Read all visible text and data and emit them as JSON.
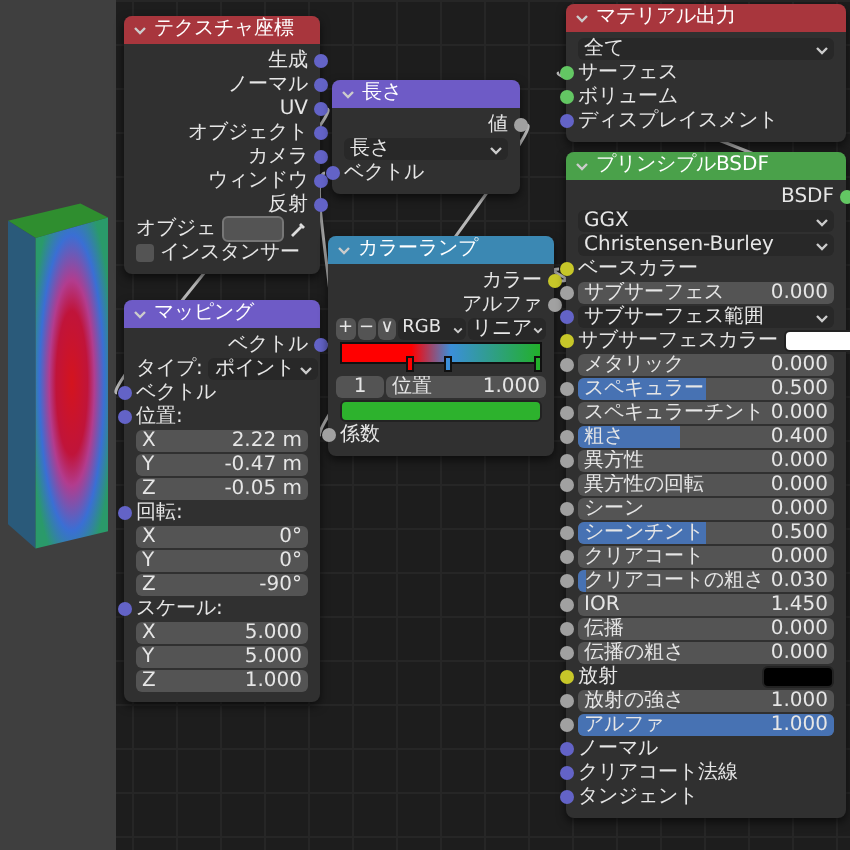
{
  "nodes": [
    {
      "title": "テクスチャ座標",
      "color": "#a8363d",
      "rows": [
        {
          "kind": "output",
          "label": "生成",
          "socket": {
            "color": "#6363c7"
          }
        },
        {
          "kind": "output",
          "label": "ノーマル",
          "socket": {
            "color": "#6363c7"
          }
        },
        {
          "kind": "output",
          "label": "UV",
          "socket": {
            "color": "#6363c7"
          }
        },
        {
          "kind": "output",
          "label": "オブジェクト",
          "socket": {
            "color": "#6363c7"
          }
        },
        {
          "kind": "output",
          "label": "カメラ",
          "socket": {
            "color": "#6363c7"
          }
        },
        {
          "kind": "output",
          "label": "ウィンドウ",
          "socket": {
            "color": "#6363c7"
          }
        },
        {
          "kind": "output",
          "label": "反射",
          "socket": {
            "color": "#6363c7"
          }
        },
        {
          "kind": "object",
          "label": "オブジェ"
        },
        {
          "kind": "checkbox",
          "label": "インスタンサー",
          "checked": false
        }
      ]
    },
    {
      "title": "マッピング",
      "color": "#6e5bc6",
      "rows": [
        {
          "kind": "output",
          "label": "ベクトル",
          "socket": {
            "color": "#6363c7"
          }
        },
        {
          "kind": "dropdown",
          "label": "タイプ:",
          "value": "ポイント"
        },
        {
          "kind": "input",
          "label": "ベクトル",
          "socket": {
            "color": "#6363c7"
          }
        },
        {
          "kind": "heading",
          "label": "位置:",
          "socket": {
            "color": "#6363c7"
          }
        },
        {
          "kind": "number",
          "label": "X",
          "value": "2.22 m"
        },
        {
          "kind": "number",
          "label": "Y",
          "value": "-0.47 m"
        },
        {
          "kind": "number",
          "label": "Z",
          "value": "-0.05 m"
        },
        {
          "kind": "heading",
          "label": "回転:",
          "socket": {
            "color": "#6363c7"
          }
        },
        {
          "kind": "number",
          "label": "X",
          "value": "0°"
        },
        {
          "kind": "number",
          "label": "Y",
          "value": "0°"
        },
        {
          "kind": "number",
          "label": "Z",
          "value": "-90°"
        },
        {
          "kind": "heading",
          "label": "スケール:",
          "socket": {
            "color": "#6363c7"
          }
        },
        {
          "kind": "number",
          "label": "X",
          "value": "5.000"
        },
        {
          "kind": "number",
          "label": "Y",
          "value": "5.000"
        },
        {
          "kind": "number",
          "label": "Z",
          "value": "1.000"
        }
      ]
    },
    {
      "title": "長さ",
      "color": "#6e5bc6",
      "rows": [
        {
          "kind": "output",
          "label": "値",
          "socket": {
            "color": "#a1a1a1"
          }
        },
        {
          "kind": "dropdown",
          "value": "長さ"
        },
        {
          "kind": "input",
          "label": "ベクトル",
          "socket": {
            "color": "#6363c7"
          }
        }
      ]
    },
    {
      "title": "カラーランプ",
      "color": "#3b88b3",
      "rows": [
        {
          "kind": "output",
          "label": "カラー",
          "socket": {
            "color": "#c7c729"
          }
        },
        {
          "kind": "output",
          "label": "アルファ",
          "socket": {
            "color": "#a1a1a1"
          }
        },
        {
          "kind": "ramp_tools",
          "add": "+",
          "remove": "−",
          "menu": "∨",
          "mode": "RGB",
          "interpolation": "リニア"
        },
        {
          "kind": "ramp",
          "stops": [
            {
              "color": "#ff0000",
              "level": 0.35
            },
            {
              "color": "#3b8fd9",
              "level": 0.55
            },
            {
              "color": "#22b02a",
              "level": 1.0
            }
          ]
        },
        {
          "kind": "stop_info",
          "index": "1",
          "label": "位置",
          "value": "1.000"
        },
        {
          "kind": "color",
          "color": "#2db22d"
        },
        {
          "kind": "input",
          "label": "係数",
          "socket": {
            "color": "#a1a1a1"
          }
        }
      ]
    },
    {
      "title": "マテリアル出力",
      "color": "#a8363d",
      "rows": [
        {
          "kind": "dropdown",
          "value": "全て"
        },
        {
          "kind": "input",
          "label": "サーフェス",
          "socket": {
            "color": "#63c763"
          }
        },
        {
          "kind": "input",
          "label": "ボリューム",
          "socket": {
            "color": "#63c763"
          }
        },
        {
          "kind": "input",
          "label": "ディスプレイスメント",
          "socket": {
            "color": "#6363c7"
          }
        }
      ]
    },
    {
      "title": "プリンシプルBSDF",
      "color": "#4aa14a",
      "rows": [
        {
          "kind": "output",
          "label": "BSDF",
          "socket": {
            "color": "#63c763"
          }
        },
        {
          "kind": "dropdown",
          "value": "GGX"
        },
        {
          "kind": "dropdown",
          "value": "Christensen-Burley"
        },
        {
          "kind": "input",
          "label": "ベースカラー",
          "socket": {
            "color": "#c7c729"
          }
        },
        {
          "kind": "slider",
          "label": "サブサーフェス",
          "value": "0.000",
          "level": 0,
          "socket": {
            "color": "#a1a1a1"
          }
        },
        {
          "kind": "dropdown",
          "value": "サブサーフェス範囲",
          "socket": {
            "color": "#6363c7"
          }
        },
        {
          "kind": "color",
          "label": "サブサーフェスカラー",
          "color": "#ffffff",
          "socket": {
            "color": "#c7c729"
          }
        },
        {
          "kind": "slider",
          "label": "メタリック",
          "value": "0.000",
          "level": 0,
          "socket": {
            "color": "#a1a1a1"
          }
        },
        {
          "kind": "slider",
          "label": "スペキュラー",
          "value": "0.500",
          "level": 0.5,
          "socket": {
            "color": "#a1a1a1"
          }
        },
        {
          "kind": "slider",
          "label": "スペキュラーチント",
          "value": "0.000",
          "level": 0,
          "socket": {
            "color": "#a1a1a1"
          }
        },
        {
          "kind": "slider",
          "label": "粗さ",
          "value": "0.400",
          "level": 0.4,
          "socket": {
            "color": "#a1a1a1"
          }
        },
        {
          "kind": "slider",
          "label": "異方性",
          "value": "0.000",
          "level": 0,
          "socket": {
            "color": "#a1a1a1"
          }
        },
        {
          "kind": "slider",
          "label": "異方性の回転",
          "value": "0.000",
          "level": 0,
          "socket": {
            "color": "#a1a1a1"
          }
        },
        {
          "kind": "slider",
          "label": "シーン",
          "value": "0.000",
          "level": 0,
          "socket": {
            "color": "#a1a1a1"
          }
        },
        {
          "kind": "slider",
          "label": "シーンチント",
          "value": "0.500",
          "level": 0.5,
          "socket": {
            "color": "#a1a1a1"
          }
        },
        {
          "kind": "slider",
          "label": "クリアコート",
          "value": "0.000",
          "level": 0,
          "socket": {
            "color": "#a1a1a1"
          }
        },
        {
          "kind": "slider",
          "label": "クリアコートの粗さ",
          "value": "0.030",
          "level": 0.03,
          "socket": {
            "color": "#a1a1a1"
          }
        },
        {
          "kind": "number",
          "label": "IOR",
          "value": "1.450",
          "socket": {
            "color": "#a1a1a1"
          }
        },
        {
          "kind": "slider",
          "label": "伝播",
          "value": "0.000",
          "level": 0,
          "socket": {
            "color": "#a1a1a1"
          }
        },
        {
          "kind": "slider",
          "label": "伝播の粗さ",
          "value": "0.000",
          "level": 0,
          "socket": {
            "color": "#a1a1a1"
          }
        },
        {
          "kind": "color",
          "label": "放射",
          "color": "#000000",
          "socket": {
            "color": "#c7c729"
          }
        },
        {
          "kind": "number",
          "label": "放射の強さ",
          "value": "1.000",
          "socket": {
            "color": "#a1a1a1"
          }
        },
        {
          "kind": "slider",
          "label": "アルファ",
          "value": "1.000",
          "level": 1,
          "socket": {
            "color": "#a1a1a1"
          }
        },
        {
          "kind": "input",
          "label": "ノーマル",
          "socket": {
            "color": "#6363c7"
          }
        },
        {
          "kind": "input",
          "label": "クリアコート法線",
          "socket": {
            "color": "#6363c7"
          }
        },
        {
          "kind": "input",
          "label": "タンジェント",
          "socket": {
            "color": "#6363c7"
          }
        }
      ]
    }
  ]
}
